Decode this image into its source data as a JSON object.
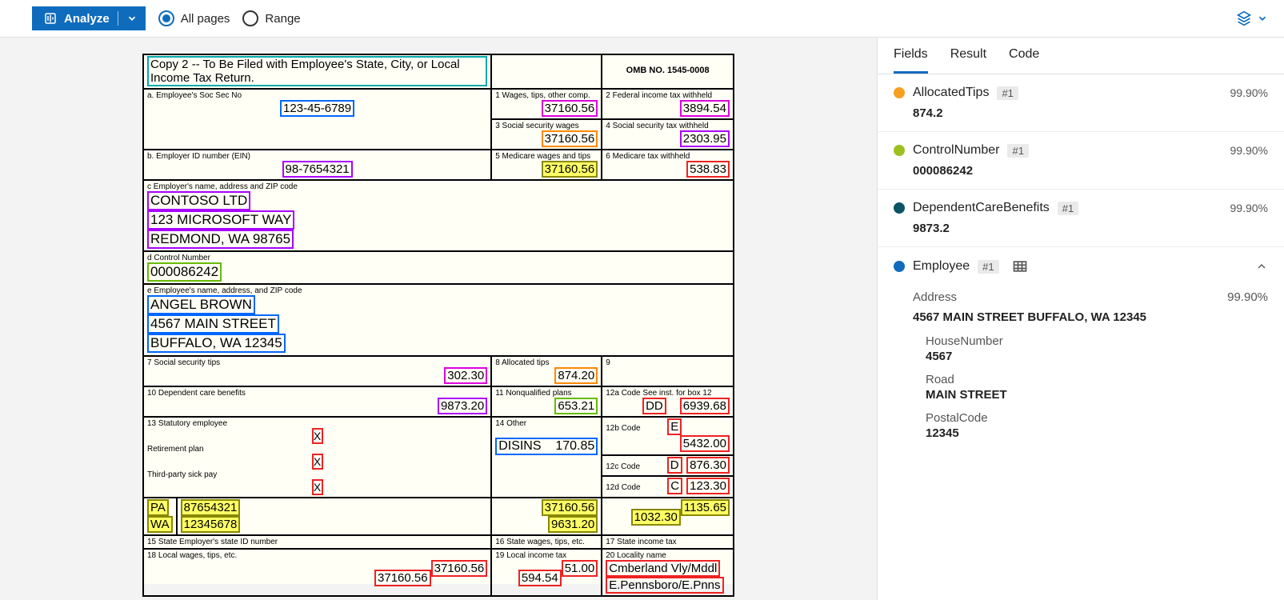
{
  "toolbar": {
    "analyze_label": "Analyze",
    "allpages_label": "All pages",
    "range_label": "Range"
  },
  "tabs": {
    "fields": "Fields",
    "result": "Result",
    "code": "Code"
  },
  "doc": {
    "copy_note": "Copy 2 -- To Be Filed with Employee's State, City, or Local Income Tax Return.",
    "omb": "OMB NO. 1545-0008",
    "a_label": "a. Employee's Soc Sec No",
    "a_val": "123-45-6789",
    "b_label": "b. Employer ID number (EIN)",
    "b_val": "98-7654321",
    "box1_label": "1 Wages, tips, other comp.",
    "box1_val": "37160.56",
    "box2_label": "2 Federal income tax withheld",
    "box2_val": "3894.54",
    "box3_label": "3 Social security wages",
    "box3_val": "37160.56",
    "box4_label": "4 Social security tax withheld",
    "box4_val": "2303.95",
    "box5_label": "5 Medicare wages and tips",
    "box5_val": "37160.56",
    "box6_label": "6 Medicare tax withheld",
    "box6_val": "538.83",
    "c_label": "c Employer's name, address and ZIP code",
    "c_val1": "CONTOSO LTD",
    "c_val2": "123 MICROSOFT WAY",
    "c_val3": "REDMOND, WA 98765",
    "d_label": "d Control Number",
    "d_val": "000086242",
    "e_label": "e Employee's name, address, and ZIP code",
    "e_val1": "ANGEL BROWN",
    "e_val2": "4567 MAIN STREET",
    "e_val3": "BUFFALO, WA 12345",
    "box7_label": "7 Social security tips",
    "box7_val": "302.30",
    "box8_label": "8 Allocated tips",
    "box8_val": "874.20",
    "box9_label": "9",
    "box10_label": "10 Dependent care benefits",
    "box10_val": "9873.20",
    "box11_label": "11 Nonqualified plans",
    "box11_val": "653.21",
    "box12a_label": "12a Code See inst. for box 12",
    "box12a_code": "DD",
    "box12a_val": "6939.68",
    "box12b_label": "12b Code",
    "box12b_code": "E",
    "box12b_val": "5432.00",
    "box12c_label": "12c Code",
    "box12c_code": "D",
    "box12c_val": "876.30",
    "box12d_label": "12d Code",
    "box12d_code": "C",
    "box12d_val": "123.30",
    "box13_label": "13 Statutory employee",
    "box13_ret": "Retirement plan",
    "box13_sick": "Third-party sick pay",
    "box14_label": "14 Other",
    "box14_val": "DISINS    170.85",
    "st1": "PA",
    "st1_id": "87654321",
    "st2": "WA",
    "st2_id": "12345678",
    "st_w1": "37160.56",
    "st_w2": "9631.20",
    "st_t1": "1135.65",
    "st_t2": "1032.30",
    "box15_label": "15 State Employer's state ID number",
    "box16_label": "16 State wages, tips, etc.",
    "box17_label": "17 State income tax",
    "box18_label": "18 Local wages, tips, etc.",
    "box19_label": "19 Local income tax",
    "box20_label": "20 Locality name",
    "lw1": "37160.56",
    "lw2": "37160.56",
    "lt1": "51.00",
    "lt2": "594.54",
    "loc1": "Cmberland Vly/Mddl",
    "loc2": "E.Pennsboro/E.Pnns"
  },
  "fields": {
    "allocated_tips": {
      "name": "AllocatedTips",
      "badge": "#1",
      "conf": "99.90%",
      "value": "874.2",
      "color": "#f8a020"
    },
    "control_number": {
      "name": "ControlNumber",
      "badge": "#1",
      "conf": "99.90%",
      "value": "000086242",
      "color": "#9dc020"
    },
    "dependent_care": {
      "name": "DependentCareBenefits",
      "badge": "#1",
      "conf": "99.90%",
      "value": "9873.2",
      "color": "#0b5563"
    },
    "employee": {
      "name": "Employee",
      "badge": "#1",
      "color": "#0f6cbd",
      "address_label": "Address",
      "address_conf": "99.90%",
      "address_val": "4567 MAIN STREET BUFFALO, WA 12345",
      "house_label": "HouseNumber",
      "house_val": "4567",
      "road_label": "Road",
      "road_val": "MAIN STREET",
      "postal_label": "PostalCode",
      "postal_val": "12345"
    }
  }
}
